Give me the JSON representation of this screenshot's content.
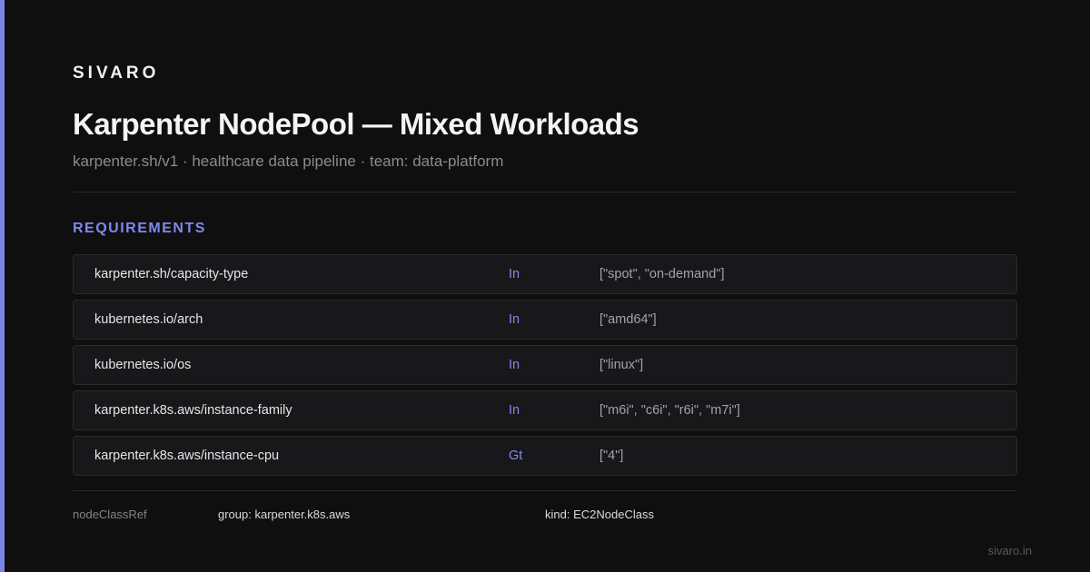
{
  "brand": "SIVARO",
  "header": {
    "title": "Karpenter NodePool — Mixed Workloads",
    "subtitle": "karpenter.sh/v1 · healthcare data pipeline · team: data-platform"
  },
  "requirements": {
    "label": "REQUIREMENTS",
    "rows": [
      {
        "key": "karpenter.sh/capacity-type",
        "operator": "In",
        "values": "[\"spot\", \"on-demand\"]"
      },
      {
        "key": "kubernetes.io/arch",
        "operator": "In",
        "values": "[\"amd64\"]"
      },
      {
        "key": "kubernetes.io/os",
        "operator": "In",
        "values": "[\"linux\"]"
      },
      {
        "key": "karpenter.k8s.aws/instance-family",
        "operator": "In",
        "values": "[\"m6i\", \"c6i\", \"r6i\", \"m7i\"]"
      },
      {
        "key": "karpenter.k8s.aws/instance-cpu",
        "operator": "Gt",
        "values": "[\"4\"]"
      }
    ]
  },
  "footer": {
    "label": "nodeClassRef",
    "group": "group: karpenter.k8s.aws",
    "kind": "kind: EC2NodeClass"
  },
  "domain": "sivaro.in",
  "colors": {
    "background": "#0f0f10",
    "accent": "#7b84e6",
    "row_background": "#18181a",
    "row_border": "#2b2b2e"
  }
}
